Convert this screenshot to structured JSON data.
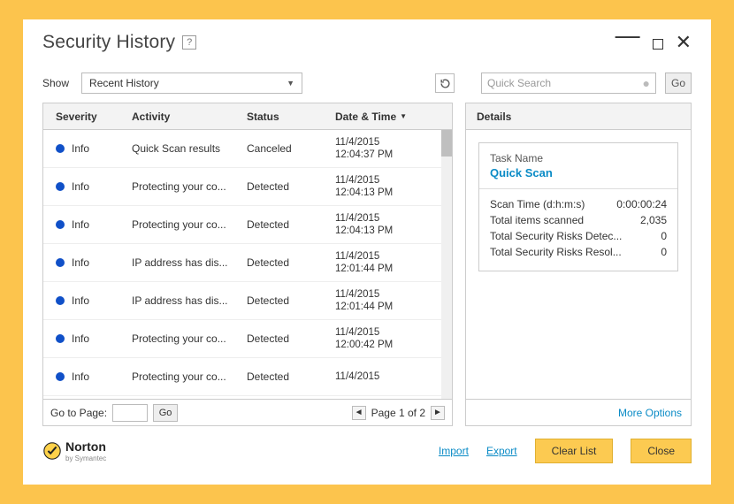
{
  "window": {
    "title": "Security History"
  },
  "filter": {
    "show_label": "Show",
    "dropdown_value": "Recent History",
    "search_placeholder": "Quick Search",
    "go_label": "Go"
  },
  "grid": {
    "headers": {
      "severity": "Severity",
      "activity": "Activity",
      "status": "Status",
      "datetime": "Date & Time"
    },
    "rows": [
      {
        "severity": "Info",
        "activity": "Quick Scan results",
        "status": "Canceled",
        "date": "11/4/2015",
        "time": "12:04:37 PM"
      },
      {
        "severity": "Info",
        "activity": "Protecting your co...",
        "status": "Detected",
        "date": "11/4/2015",
        "time": "12:04:13 PM"
      },
      {
        "severity": "Info",
        "activity": "Protecting your co...",
        "status": "Detected",
        "date": "11/4/2015",
        "time": "12:04:13 PM"
      },
      {
        "severity": "Info",
        "activity": "IP address has dis...",
        "status": "Detected",
        "date": "11/4/2015",
        "time": "12:01:44 PM"
      },
      {
        "severity": "Info",
        "activity": "IP address has dis...",
        "status": "Detected",
        "date": "11/4/2015",
        "time": "12:01:44 PM"
      },
      {
        "severity": "Info",
        "activity": "Protecting your co...",
        "status": "Detected",
        "date": "11/4/2015",
        "time": "12:00:42 PM"
      },
      {
        "severity": "Info",
        "activity": "Protecting your co...",
        "status": "Detected",
        "date": "11/4/2015",
        "time": ""
      }
    ],
    "pager": {
      "goto_label": "Go to Page:",
      "go_label": "Go",
      "page_text": "Page 1 of 2"
    }
  },
  "details": {
    "header": "Details",
    "task_label": "Task Name",
    "task_name": "Quick Scan",
    "rows": [
      {
        "label": "Scan Time (d:h:m:s)",
        "value": "0:00:00:24"
      },
      {
        "label": "Total items scanned",
        "value": "2,035"
      },
      {
        "label": "Total Security Risks Detec...",
        "value": "0"
      },
      {
        "label": "Total Security Risks Resol...",
        "value": "0"
      }
    ],
    "more_options": "More Options"
  },
  "footer": {
    "brand": "Norton",
    "sub": "by Symantec",
    "import": "Import",
    "export": "Export",
    "clear": "Clear List",
    "close": "Close"
  }
}
